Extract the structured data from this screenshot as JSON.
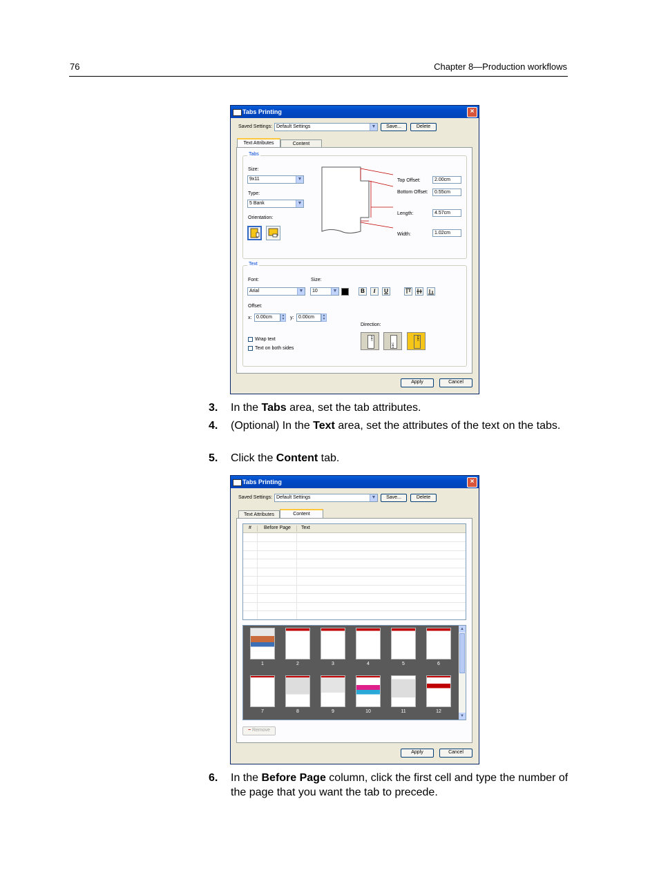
{
  "page": {
    "number": "76",
    "chapter": "Chapter 8—Production workflows"
  },
  "dialog": {
    "title": "Tabs Printing",
    "saved_settings_label": "Saved Settings:",
    "saved_settings_value": "Default Settings",
    "save_label": "Save...",
    "delete_label": "Delete",
    "tab_text_attributes": "Text Attributes",
    "tab_content": "Content",
    "apply_label": "Apply",
    "cancel_label": "Cancel"
  },
  "tabs_group": {
    "title": "Tabs",
    "size_label": "Size:",
    "size_value": "9x11",
    "type_label": "Type:",
    "type_value": "5 Bank",
    "orientation_label": "Orientation:",
    "top_offset_label": "Top Offset:",
    "top_offset_value": "2.00cm",
    "bottom_offset_label": "Bottom Offset:",
    "bottom_offset_value": "0.55cm",
    "length_label": "Length:",
    "length_value": "4.57cm",
    "width_label": "Width:",
    "width_value": "1.02cm"
  },
  "text_group": {
    "title": "Text",
    "font_label": "Font:",
    "font_value": "Arial",
    "size_label": "Size:",
    "size_value": "10",
    "bold": "B",
    "italic": "I",
    "underline": "U",
    "offset_label": "Offset:",
    "x_label": "x:",
    "x_value": "0.00cm",
    "y_label": "y:",
    "y_value": "0.00cm",
    "direction_label": "Direction:",
    "dir_1": "ABC",
    "dir_2": "ABC",
    "dir_3": "ABC",
    "wrap_text": "Wrap text",
    "text_both_sides": "Text on both sides"
  },
  "content_tab": {
    "col_num": "#",
    "col_before_page": "Before Page",
    "col_text": "Text",
    "thumbnails": [
      "1",
      "2",
      "3",
      "4",
      "5",
      "6",
      "7",
      "8",
      "9",
      "10",
      "11",
      "12"
    ],
    "remove_label": "Remove"
  },
  "steps": [
    {
      "num": "3.",
      "pre": "In the ",
      "bold": "Tabs",
      "post": " area, set the tab attributes."
    },
    {
      "num": "4.",
      "pre": "(Optional) In the ",
      "bold": "Text",
      "post": " area, set the attributes of the text on the tabs."
    },
    {
      "num": "5.",
      "pre": "Click the ",
      "bold": "Content",
      "post": " tab."
    },
    {
      "num": "6.",
      "pre": "In the ",
      "bold": "Before Page",
      "post": " column, click the first cell and type the number of the page that you want the tab to precede."
    }
  ]
}
